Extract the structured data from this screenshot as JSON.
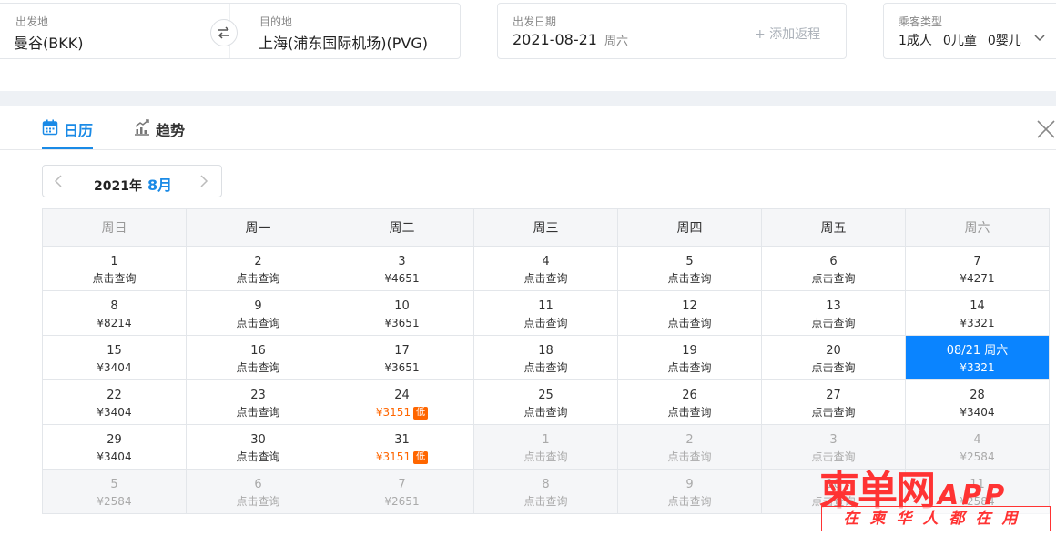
{
  "search": {
    "departure": {
      "label": "出发地",
      "value": "曼谷(BKK)"
    },
    "destination": {
      "label": "目的地",
      "value": "上海(浦东国际机场)(PVG)"
    },
    "date": {
      "label": "出发日期",
      "value": "2021-08-21",
      "weekday": "周六"
    },
    "add_return": "+ 添加返程",
    "passengers": {
      "label": "乘客类型",
      "adults": "1成人",
      "children": "0儿童",
      "infants": "0婴儿"
    }
  },
  "tabs": [
    {
      "label": "日历",
      "icon": "calendar-icon",
      "active": true
    },
    {
      "label": "趋势",
      "icon": "trend-chart-icon",
      "active": false
    }
  ],
  "month_picker": {
    "year": "2021年",
    "month": "8月"
  },
  "calendar": {
    "weekdays": [
      "周日",
      "周一",
      "周二",
      "周三",
      "周四",
      "周五",
      "周六"
    ],
    "weeks": [
      [
        {
          "d": "1",
          "p": "点击查询"
        },
        {
          "d": "2",
          "p": "点击查询"
        },
        {
          "d": "3",
          "p": "¥4651"
        },
        {
          "d": "4",
          "p": "点击查询"
        },
        {
          "d": "5",
          "p": "点击查询"
        },
        {
          "d": "6",
          "p": "点击查询"
        },
        {
          "d": "7",
          "p": "¥4271"
        }
      ],
      [
        {
          "d": "8",
          "p": "¥8214"
        },
        {
          "d": "9",
          "p": "点击查询"
        },
        {
          "d": "10",
          "p": "¥3651"
        },
        {
          "d": "11",
          "p": "点击查询"
        },
        {
          "d": "12",
          "p": "点击查询"
        },
        {
          "d": "13",
          "p": "点击查询"
        },
        {
          "d": "14",
          "p": "¥3321"
        }
      ],
      [
        {
          "d": "15",
          "p": "¥3404"
        },
        {
          "d": "16",
          "p": "点击查询"
        },
        {
          "d": "17",
          "p": "¥3651"
        },
        {
          "d": "18",
          "p": "点击查询"
        },
        {
          "d": "19",
          "p": "点击查询"
        },
        {
          "d": "20",
          "p": "点击查询"
        },
        {
          "d": "08/21 周六",
          "p": "¥3321",
          "selected": true
        }
      ],
      [
        {
          "d": "22",
          "p": "¥3404"
        },
        {
          "d": "23",
          "p": "点击查询"
        },
        {
          "d": "24",
          "p": "¥3151",
          "low": true
        },
        {
          "d": "25",
          "p": "点击查询"
        },
        {
          "d": "26",
          "p": "点击查询"
        },
        {
          "d": "27",
          "p": "点击查询"
        },
        {
          "d": "28",
          "p": "¥3404"
        }
      ],
      [
        {
          "d": "29",
          "p": "¥3404"
        },
        {
          "d": "30",
          "p": "点击查询"
        },
        {
          "d": "31",
          "p": "¥3151",
          "low": true
        },
        {
          "d": "1",
          "p": "点击查询",
          "other": true
        },
        {
          "d": "2",
          "p": "点击查询",
          "other": true
        },
        {
          "d": "3",
          "p": "点击查询",
          "other": true
        },
        {
          "d": "4",
          "p": "¥2584",
          "other": true
        }
      ],
      [
        {
          "d": "5",
          "p": "¥2584",
          "other": true
        },
        {
          "d": "6",
          "p": "点击查询",
          "other": true
        },
        {
          "d": "7",
          "p": "¥2651",
          "other": true
        },
        {
          "d": "8",
          "p": "点击查询",
          "other": true
        },
        {
          "d": "9",
          "p": "点击查询",
          "other": true
        },
        {
          "d": "10",
          "p": "点击查询",
          "other": true
        },
        {
          "d": "11",
          "p": "¥2584",
          "other": true
        }
      ]
    ],
    "low_badge": "低"
  },
  "watermark": {
    "brand": "柬单网",
    "app": "APP",
    "slogan": "在柬华人都在用"
  },
  "colors": {
    "accent": "#1a8ae6",
    "selected": "#0a84ff",
    "low_price": "#ff6600",
    "watermark": "#ff3333"
  }
}
